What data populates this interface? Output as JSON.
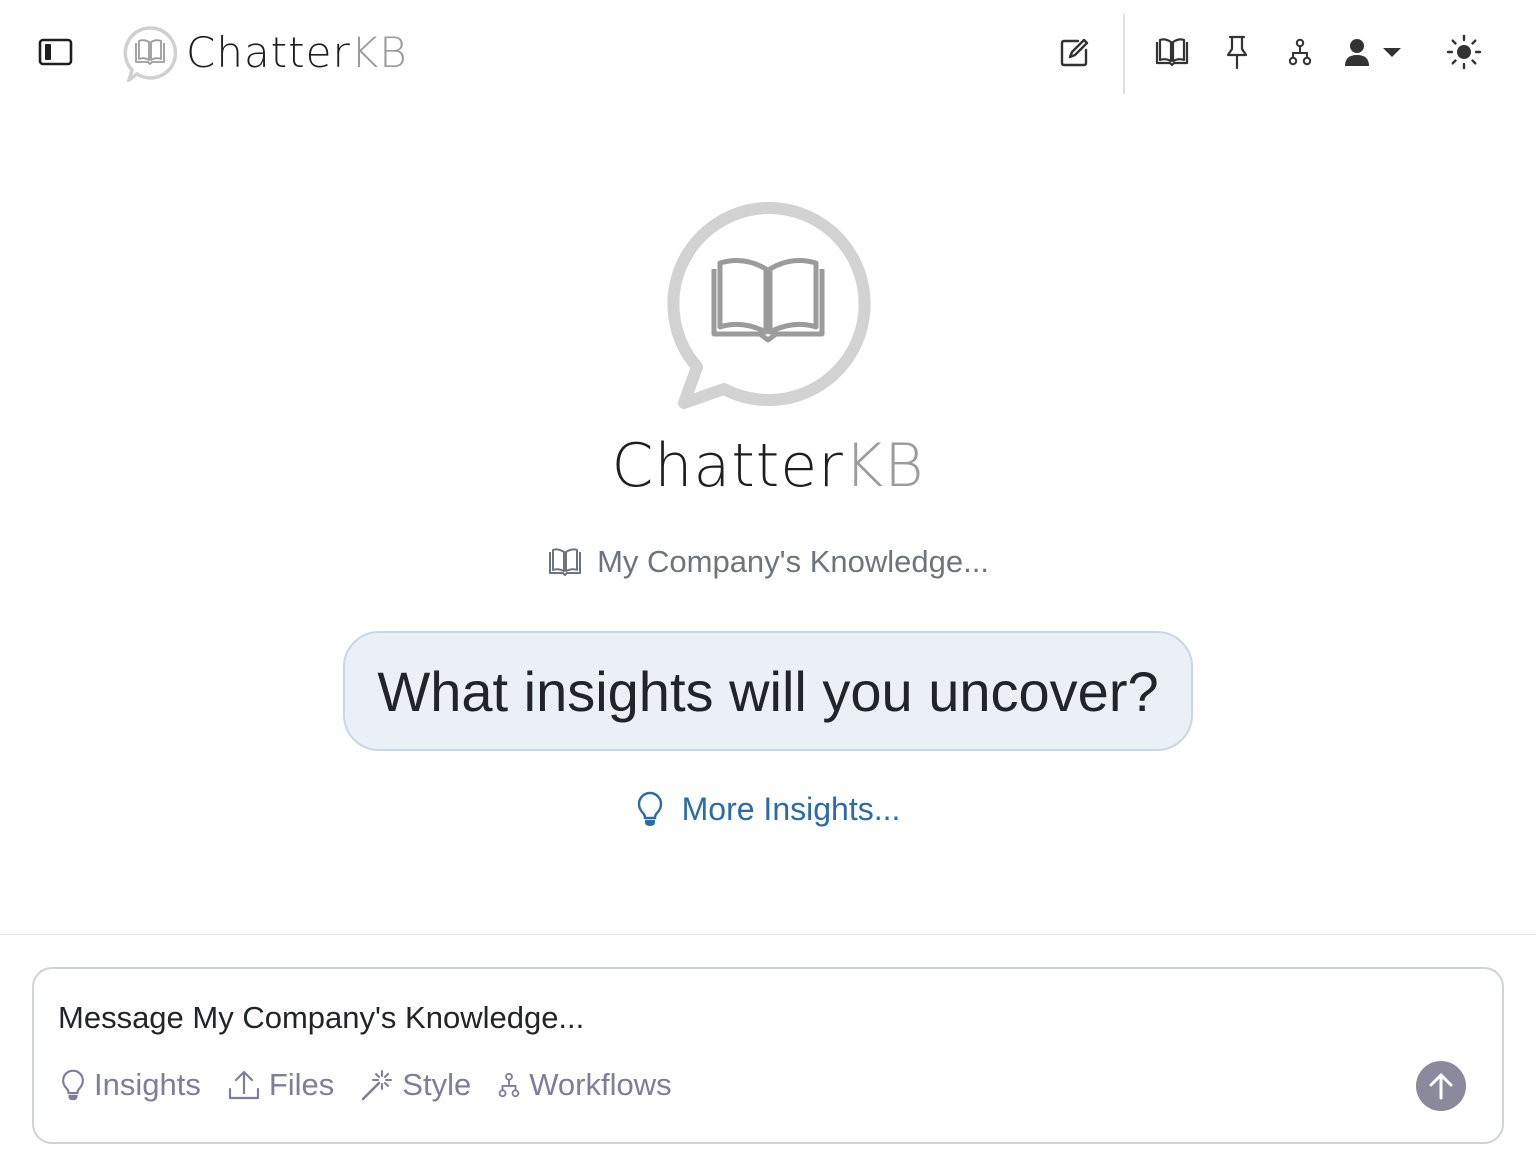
{
  "header": {
    "logo_dark": "Chatter",
    "logo_light": "KB",
    "buttons": [
      "new-chat",
      "knowledge-bases",
      "pinned",
      "workflows",
      "account",
      "theme"
    ]
  },
  "hero": {
    "logo_dark": "Chatter",
    "logo_light": "KB",
    "kb_label": "My Company's Knowledge...",
    "prompt": "What insights will you uncover?",
    "more_insights": "More Insights..."
  },
  "composer": {
    "placeholder": "Message My Company's Knowledge...",
    "tools": {
      "insights": "Insights",
      "files": "Files",
      "style": "Style",
      "workflows": "Workflows"
    }
  },
  "colors": {
    "accent_link": "#2c6aa8",
    "bubble_bg": "#ebf0f7",
    "bubble_border": "#c7d7ea",
    "muted": "#7d7e99",
    "send_button": "#8a8a9c"
  }
}
